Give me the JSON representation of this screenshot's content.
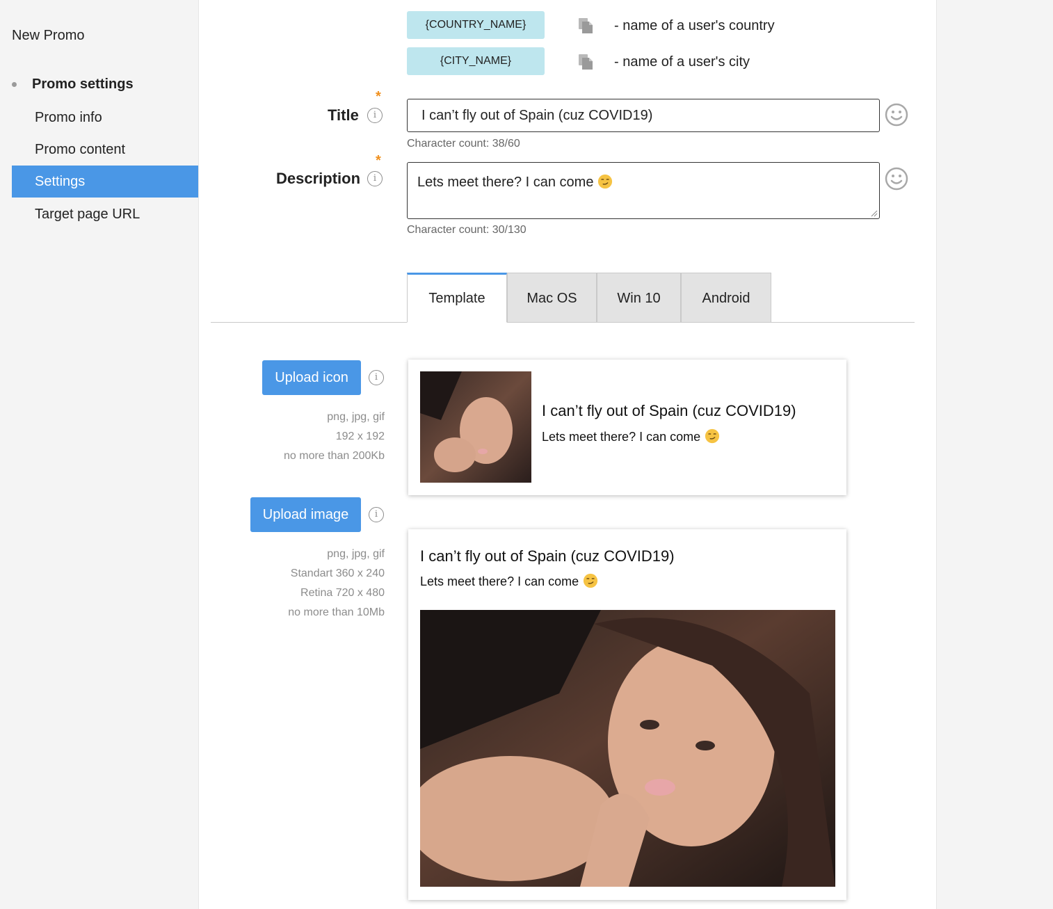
{
  "sidebar": {
    "app_title": "New Promo",
    "section_label": "Promo settings",
    "items": [
      {
        "label": "Promo info",
        "active": false
      },
      {
        "label": "Promo content",
        "active": false
      },
      {
        "label": "Settings",
        "active": true
      },
      {
        "label": "Target page URL",
        "active": false
      }
    ]
  },
  "tokens": [
    {
      "token": "{COUNTRY_NAME}",
      "description": "- name of a user's country"
    },
    {
      "token": "{CITY_NAME}",
      "description": "- name of a user's city"
    }
  ],
  "form": {
    "title": {
      "label": "Title",
      "value": "I can’t fly out of Spain (cuz COVID19)",
      "char_count": "Character count: 38/60"
    },
    "description": {
      "label": "Description",
      "value": "Lets meet there? I can come",
      "char_count": "Character count: 30/130"
    },
    "required_mark": "*"
  },
  "tabs": [
    {
      "label": "Template",
      "active": true
    },
    {
      "label": "Mac OS",
      "active": false
    },
    {
      "label": "Win 10",
      "active": false
    },
    {
      "label": "Android",
      "active": false
    }
  ],
  "upload_icon": {
    "button_label": "Upload icon",
    "hints": [
      "png, jpg, gif",
      "192 x 192",
      "no more than 200Kb"
    ]
  },
  "upload_image": {
    "button_label": "Upload image",
    "hints": [
      "png, jpg, gif",
      "Standart 360 x 240",
      "Retina 720 x 480",
      "no more than 10Mb"
    ]
  },
  "preview": {
    "title": "I can’t fly out of Spain (cuz COVID19)",
    "description": "Lets meet there? I can come"
  },
  "colors": {
    "accent": "#4a97e6",
    "token_bg": "#bee6ee",
    "required": "#f0901e"
  },
  "icons": {
    "copy": "copy-icon",
    "info": "info-icon",
    "emoji_picker": "smiley-icon",
    "emoji": "smirk-emoji"
  }
}
